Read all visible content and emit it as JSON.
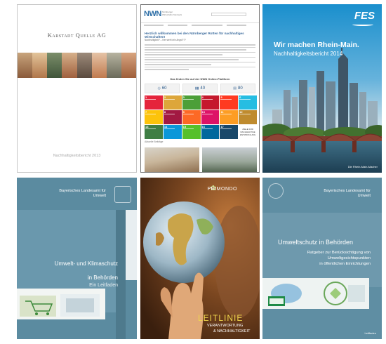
{
  "covers": {
    "karstadt": {
      "brand": "Karstadt Quelle AG",
      "footer": "Nachhaltigkeitsbericht 2013"
    },
    "nwn": {
      "logo_main": "NWN",
      "logo_sub": "Nürnberger Wirtschafts Netzwerk",
      "headline": "Herzlich willkommen bei den Nürnberger Rotten für nachhaltiges Wirtschaften!",
      "subheadline": "Nachhaltigkeit? – hier steht drin Angst???",
      "section_title": "Das finden Sie auf der NWN Online-Plattform",
      "counters": [
        {
          "icon": "target-icon",
          "value": "60"
        },
        {
          "icon": "people-icon",
          "value": "40"
        },
        {
          "icon": "calendar-icon",
          "value": "80"
        }
      ],
      "sdg_tiles": [
        {
          "n": "1",
          "color": "#e5243b"
        },
        {
          "n": "2",
          "color": "#dda63a"
        },
        {
          "n": "3",
          "color": "#4c9f38"
        },
        {
          "n": "4",
          "color": "#c5192d"
        },
        {
          "n": "5",
          "color": "#ff3a21"
        },
        {
          "n": "6",
          "color": "#26bde2"
        },
        {
          "n": "7",
          "color": "#fcc30b"
        },
        {
          "n": "8",
          "color": "#a21942"
        },
        {
          "n": "9",
          "color": "#fd6925"
        },
        {
          "n": "10",
          "color": "#dd1367"
        },
        {
          "n": "11",
          "color": "#fd9d24"
        },
        {
          "n": "12",
          "color": "#bf8b2e"
        },
        {
          "n": "13",
          "color": "#3f7e44"
        },
        {
          "n": "14",
          "color": "#0a97d9"
        },
        {
          "n": "15",
          "color": "#56c02b"
        },
        {
          "n": "16",
          "color": "#00689d"
        },
        {
          "n": "17",
          "color": "#19486a"
        }
      ],
      "sdg_logo": "ZIELE FÜR NACHHALTIGE ENTWICKLUNG",
      "more_label": "Aktuelle Beiträge"
    },
    "fes": {
      "logo": "FES",
      "title": "Wir machen Rhein-Main.",
      "subtitle": "Nachhaltigkeitsbericht 2014",
      "credit": "Die Rhein-Main-Macher"
    },
    "klimaschutz": {
      "institution": [
        "Bayerisches Landesamt für",
        "Umwelt"
      ],
      "title": "Umwelt- und Klimaschutz",
      "title2": "in Behörden",
      "lead": "Ein Leitfaden"
    },
    "primondo": {
      "logo": "PRIMONDO",
      "title": "LEITLINIE",
      "line1": "VERANTWORTUNG",
      "line2": "& NACHHALTIGKEIT"
    },
    "umweltschutz": {
      "institution": [
        "Bayerisches Landesamt für",
        "Umwelt"
      ],
      "title": "Umweltschutz in Behörden",
      "lines": [
        "Ratgeber zur Berücksichtigung von",
        "Umweltgesichtspunkten",
        "in öffentlichen Einrichtungen"
      ],
      "footer": "Leitfaden"
    }
  }
}
